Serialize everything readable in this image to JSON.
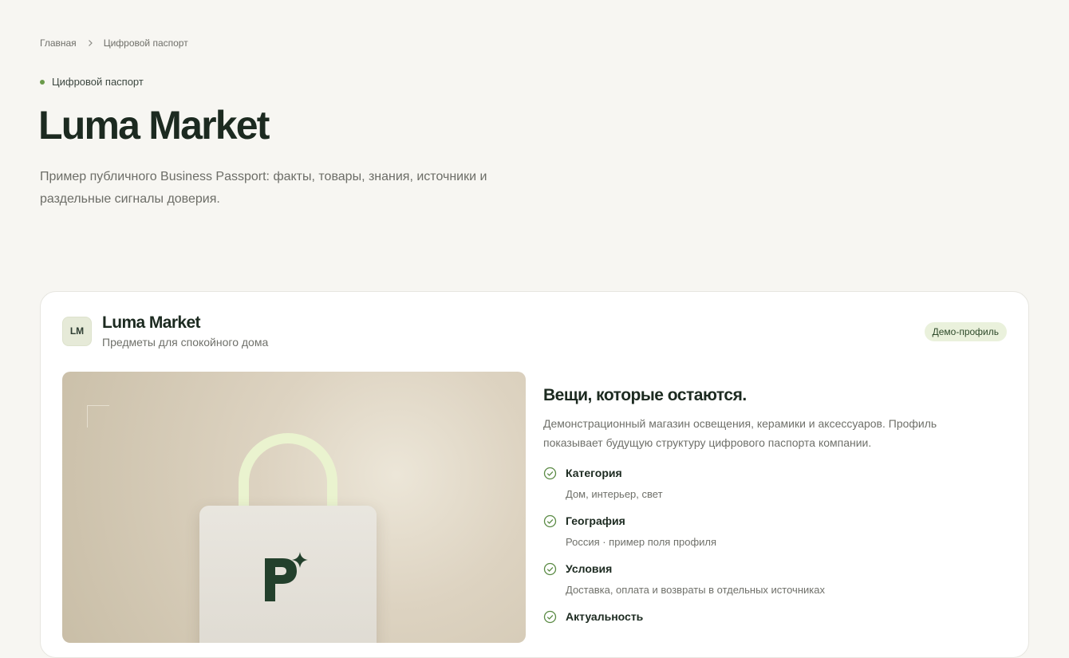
{
  "breadcrumb": {
    "home": "Главная",
    "current": "Цифровой паспорт"
  },
  "eyebrow": "Цифровой паспорт",
  "title": "Luma Market",
  "lead": "Пример публичного Business Passport: факты, товары, знания, источники и раздельные сигналы доверия.",
  "card": {
    "avatar": "LM",
    "name": "Luma Market",
    "tagline": "Предметы для спокойного дома",
    "badge": "Демо-профиль",
    "heading": "Вещи, которые остаются.",
    "description": "Демонстрационный магазин освещения, керамики и аксессуаров. Профиль показывает будущую структуру цифрового паспорта компании.",
    "features": [
      {
        "title": "Категория",
        "value": "Дом, интерьер, свет"
      },
      {
        "title": "География",
        "value": "Россия · пример поля профиля"
      },
      {
        "title": "Условия",
        "value": "Доставка, оплата и возвраты в отдельных источниках"
      },
      {
        "title": "Актуальность",
        "value": ""
      }
    ]
  },
  "colors": {
    "accent": "#6a9a4a",
    "badge_bg": "#eaf1dc",
    "title": "#1c2a20"
  },
  "icons": {
    "breadcrumb_separator": "chevron-right-icon",
    "feature_marker": "check-circle-icon",
    "hero_logo": "passport-logo-icon"
  }
}
